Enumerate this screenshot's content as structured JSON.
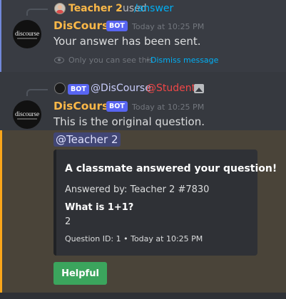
{
  "message1": {
    "reply_user": "Teacher 2",
    "reply_used": "used",
    "reply_command": "/answer",
    "author": "DisCourse",
    "bot_badge": "BOT",
    "timestamp": "Today at 10:25 PM",
    "content": "Your answer has been sent.",
    "ephemeral_note": "Only you can see this",
    "separator": "•",
    "dismiss_link": "Dismiss message"
  },
  "message2": {
    "reply_bot_badge": "BOT",
    "reply_mention_user": "@DisCourse",
    "reply_mention_role": "@Student",
    "author": "DisCourse",
    "bot_badge": "BOT",
    "timestamp": "Today at 10:25 PM",
    "content": "This is the original question.",
    "mention": "@Teacher 2",
    "embed": {
      "title": "A classmate answered your question!",
      "description": "Answered by: Teacher 2 #7830",
      "field_name": "What is 1+1?",
      "field_value": "2",
      "footer": "Question ID: 1 • Today at 10:25 PM"
    },
    "button_label": "Helpful"
  },
  "avatar_text": "discourse",
  "colors": {
    "background": "#36393f",
    "username": "#fbb848",
    "link": "#00aff4",
    "bot_badge": "#5865f2",
    "mention_highlight": "#4a4439",
    "mention_bar": "#faa61a",
    "button": "#3ba55d"
  }
}
